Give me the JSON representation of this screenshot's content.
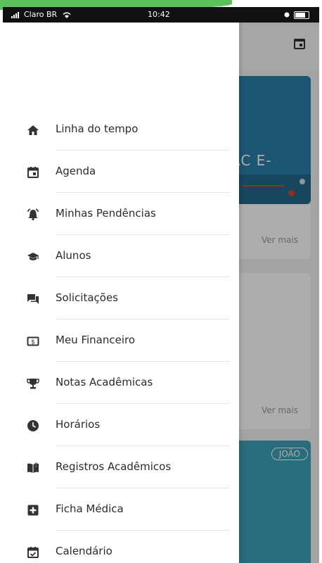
{
  "status_bar": {
    "carrier": "Claro BR",
    "time": "10:42"
  },
  "background": {
    "card_partial_text": "AC E-",
    "see_more_1": "Ver mais",
    "see_more_2": "Ver mais",
    "badge": "JOÃO"
  },
  "menu": {
    "items": [
      {
        "label": "Linha do tempo",
        "icon": "home-icon"
      },
      {
        "label": "Agenda",
        "icon": "calendar-today-icon"
      },
      {
        "label": "Minhas Pendências",
        "icon": "alarm-bell-icon"
      },
      {
        "label": "Alunos",
        "icon": "graduation-cap-icon"
      },
      {
        "label": "Solicitações",
        "icon": "chat-forum-icon"
      },
      {
        "label": "Meu Financeiro",
        "icon": "money-bill-icon"
      },
      {
        "label": "Notas Acadêmicas",
        "icon": "trophy-icon"
      },
      {
        "label": "Horários",
        "icon": "clock-icon"
      },
      {
        "label": "Registros Acadêmicos",
        "icon": "open-book-icon"
      },
      {
        "label": "Ficha Médica",
        "icon": "medical-plus-icon"
      },
      {
        "label": "Calendário",
        "icon": "calendar-check-icon"
      }
    ]
  }
}
